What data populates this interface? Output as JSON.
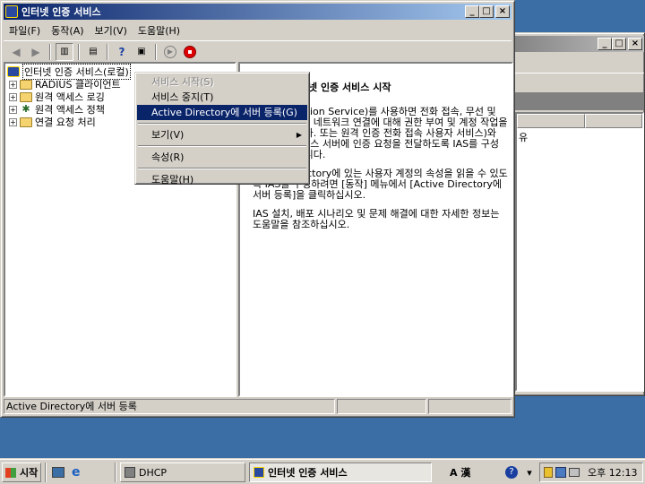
{
  "background_window": {
    "header_text": "유"
  },
  "main_window": {
    "title": "인터넷 인증 서비스",
    "menu": [
      "파일(F)",
      "동작(A)",
      "보기(V)",
      "도움말(H)"
    ],
    "tree": [
      {
        "label": "인터넷 인증 서비스(로컬)",
        "selected": true
      },
      {
        "label": "RADIUS 클라이언트"
      },
      {
        "label": "원격 액세스 로깅"
      },
      {
        "label": "원격 액세스 정책"
      },
      {
        "label": "연결 요청 처리"
      }
    ],
    "description": {
      "heading": "넷 인증 서비스 시작",
      "p1": "Authentication Service)를 사용하면 전화 접속, 무선 및 이더넷을 통한 네트워크 연결에 대해 권한 부여 및 계정 작업을 할 수 있습니다. 또는 원격 인증 전화 접속 사용자 서비스)와 호환되는 액세스 서버에 인증 요청을 전달하도록 IAS를 구성할 수도 있습니다.",
      "p2": "Active Directory에 있는 사용자 계정의 속성을 읽을 수 있도록 IAS를 구성하려면 [동작] 메뉴에서 [Active Directory에 서버 등록]을 클릭하십시오.",
      "p3": "IAS 설치, 배포 시나리오 및 문제 해결에 대한 자세한 정보는 도움말을 참조하십시오."
    },
    "status": "Active Directory에 서버 등록"
  },
  "context_menu": {
    "items": [
      {
        "label": "서비스 시작(S)",
        "disabled": true
      },
      {
        "label": "서비스 중지(T)"
      },
      {
        "label": "Active Directory에 서버 등록(G)",
        "highlighted": true
      },
      {
        "label": "보기(V)",
        "submenu": true
      },
      {
        "label": "속성(R)"
      },
      {
        "label": "도움말(H)"
      }
    ]
  },
  "taskbar": {
    "start": "시작",
    "tasks": [
      "DHCP",
      "인터넷 인증 서비스"
    ],
    "ime": "A 漢",
    "clock": "오후 12:13"
  },
  "colors": {
    "desktop": "#3a6ea5",
    "title_active": "#0a246a",
    "face": "#d4d0c8"
  }
}
